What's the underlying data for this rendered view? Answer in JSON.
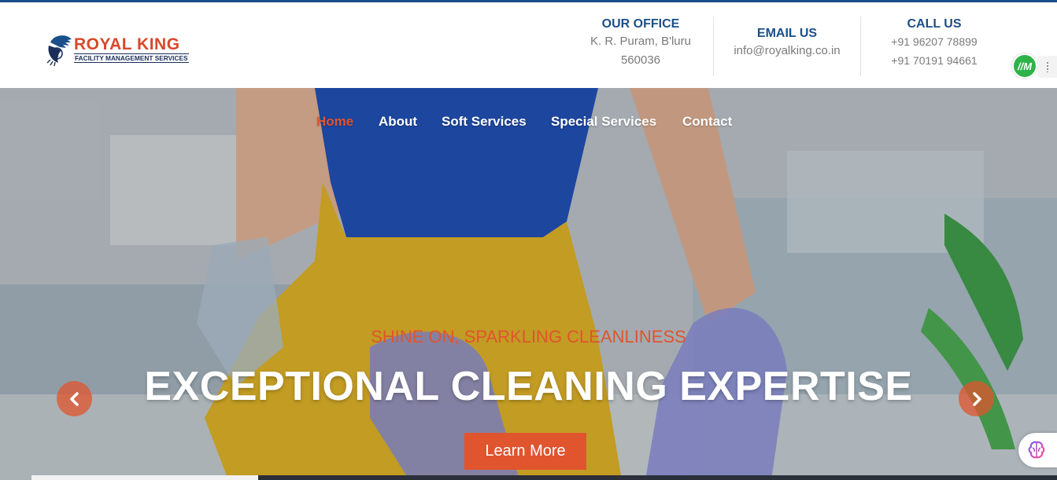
{
  "brand": {
    "name": "ROYAL KING",
    "tagline": "FACILITY MANAGEMENT SERVICES",
    "primary_color": "#1b4f8a",
    "accent_color": "#e0542e"
  },
  "contact": {
    "office": {
      "title": "OUR OFFICE",
      "line1": "K. R. Puram, B'luru",
      "line2": "560036"
    },
    "email": {
      "title": "EMAIL US",
      "value": "info@royalking.co.in"
    },
    "call": {
      "title": "CALL US",
      "phone1": "+91 96207 78899",
      "phone2": "+91 70191 94661"
    }
  },
  "extension": {
    "badge_text": "//M"
  },
  "nav": {
    "items": [
      {
        "label": "Home",
        "active": true
      },
      {
        "label": "About",
        "active": false
      },
      {
        "label": "Soft Services",
        "active": false
      },
      {
        "label": "Special Services",
        "active": false
      },
      {
        "label": "Contact",
        "active": false
      }
    ]
  },
  "hero": {
    "kicker": "SHINE ON, SPARKLING CLEANLINESS",
    "headline": "EXCEPTIONAL CLEANING EXPERTISE",
    "cta_label": "Learn More",
    "prev_icon": "chevron-left-icon",
    "next_icon": "chevron-right-icon"
  }
}
